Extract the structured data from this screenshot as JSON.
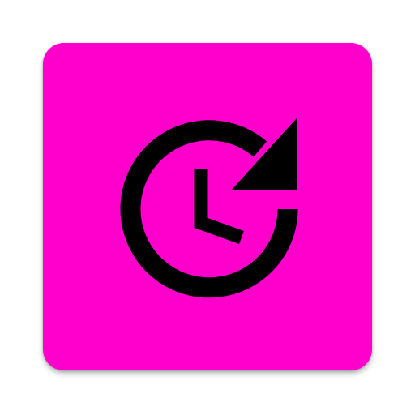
{
  "app_icon": {
    "icon": "clock-refresh-icon",
    "background_color": "#ff00cc",
    "glyph_color": "#000000"
  }
}
